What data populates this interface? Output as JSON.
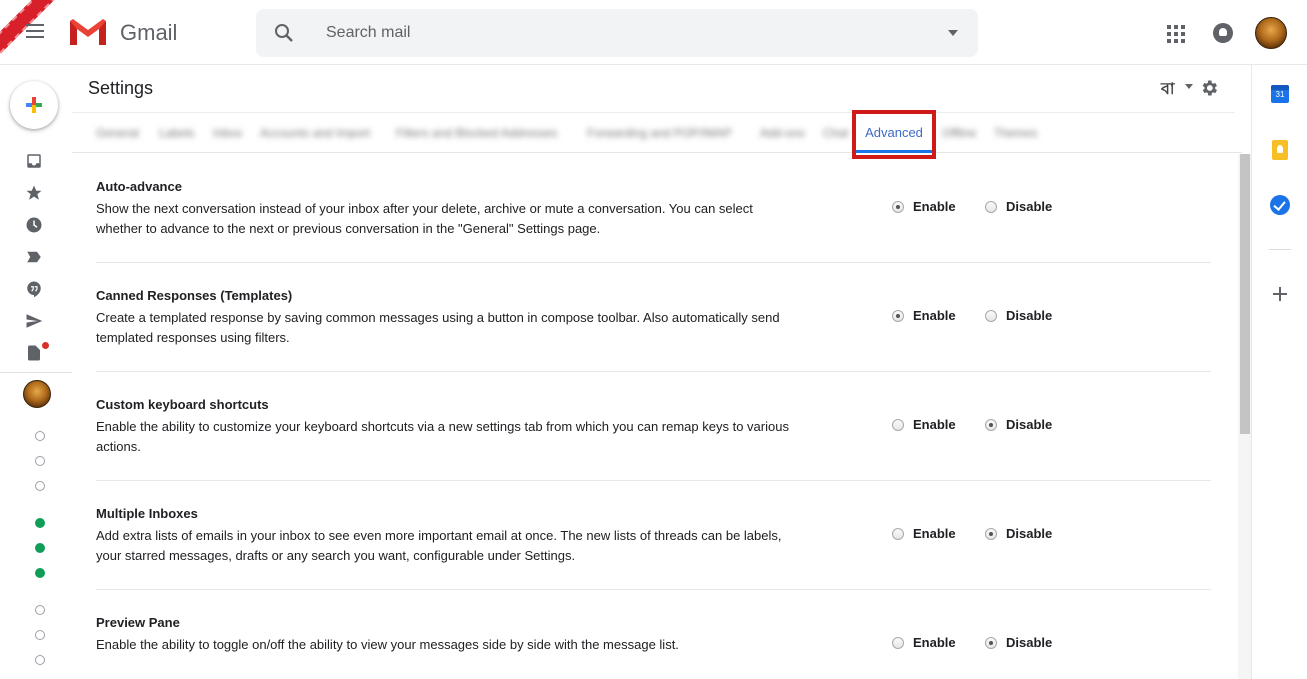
{
  "header": {
    "app_name": "Gmail",
    "search_placeholder": "Search mail"
  },
  "settings": {
    "title": "Settings",
    "language_label": "বা"
  },
  "tabs": {
    "items": [
      "General",
      "Labels",
      "Inbox",
      "Accounts and Import",
      "Filters and Blocked Addresses",
      "Forwarding and POP/IMAP",
      "Add-ons",
      "Chat",
      "Offline",
      "Themes"
    ],
    "active": "Advanced"
  },
  "rows": [
    {
      "title": "Auto-advance",
      "description": "Show the next conversation instead of your inbox after your delete, archive or mute a conversation. You can select whether to advance to the next or previous conversation in the \"General\" Settings page.",
      "enable_label": "Enable",
      "disable_label": "Disable",
      "selected": "enable"
    },
    {
      "title": "Canned Responses (Templates)",
      "description": "Create a templated response by saving common messages using a button in compose toolbar. Also automatically send templated responses using filters.",
      "enable_label": "Enable",
      "disable_label": "Disable",
      "selected": "enable"
    },
    {
      "title": "Custom keyboard shortcuts",
      "description": "Enable the ability to customize your keyboard shortcuts via a new settings tab from which you can remap keys to various actions.",
      "enable_label": "Enable",
      "disable_label": "Disable",
      "selected": "disable"
    },
    {
      "title": "Multiple Inboxes",
      "description": "Add extra lists of emails in your inbox to see even more important email at once. The new lists of threads can be labels, your starred messages, drafts or any search you want, configurable under Settings.",
      "enable_label": "Enable",
      "disable_label": "Disable",
      "selected": "disable"
    },
    {
      "title": "Preview Pane",
      "description": "Enable the ability to toggle on/off the ability to view your messages side by side with the message list.",
      "enable_label": "Enable",
      "disable_label": "Disable",
      "selected": "disable"
    }
  ],
  "side_panel": {
    "calendar_day": "31"
  },
  "colors": {
    "accent": "#1a73e8",
    "highlight_box": "#d01a1a",
    "online_status": "#0f9d58",
    "draft_badge": "#d93025"
  },
  "rail_icons": [
    "inbox-icon",
    "star-icon",
    "clock-icon",
    "label-icon",
    "chat-icon",
    "send-icon",
    "draft-icon"
  ],
  "hangouts_status": [
    "offline",
    "offline",
    "offline",
    "online",
    "online",
    "online",
    "offline",
    "offline",
    "offline"
  ]
}
